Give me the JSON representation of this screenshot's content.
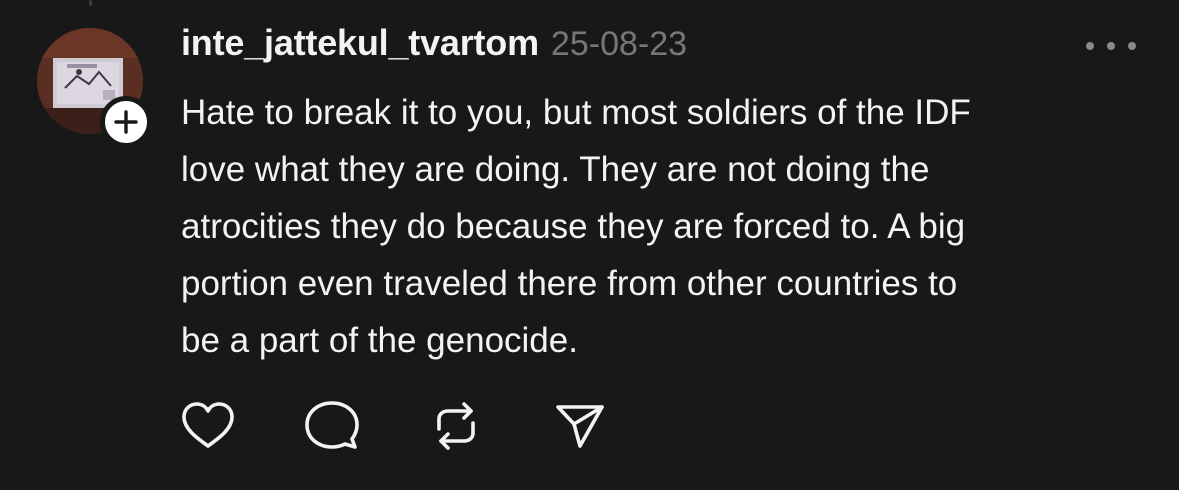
{
  "post": {
    "username": "inte_jattekul_tvartom",
    "timestamp": "25-08-23",
    "body": "Hate to break it to you, but most soldiers of the IDF\nlove what they are doing. They are not doing the\natrocities they do because they are forced to. A big\nportion even traveled there from other countries to\nbe a part of the genocide."
  },
  "icons": {
    "avatar": "profile-photo",
    "follow": "plus-icon",
    "more": "more-dots-icon",
    "like": "heart-icon",
    "reply": "comment-bubble-icon",
    "repost": "repost-icon",
    "share": "send-paper-plane-icon"
  },
  "colors": {
    "background": "#181818",
    "text_primary": "#f3f3f3",
    "text_secondary": "#777777",
    "icon": "#f3f3f3",
    "badge_bg": "#ffffff"
  }
}
